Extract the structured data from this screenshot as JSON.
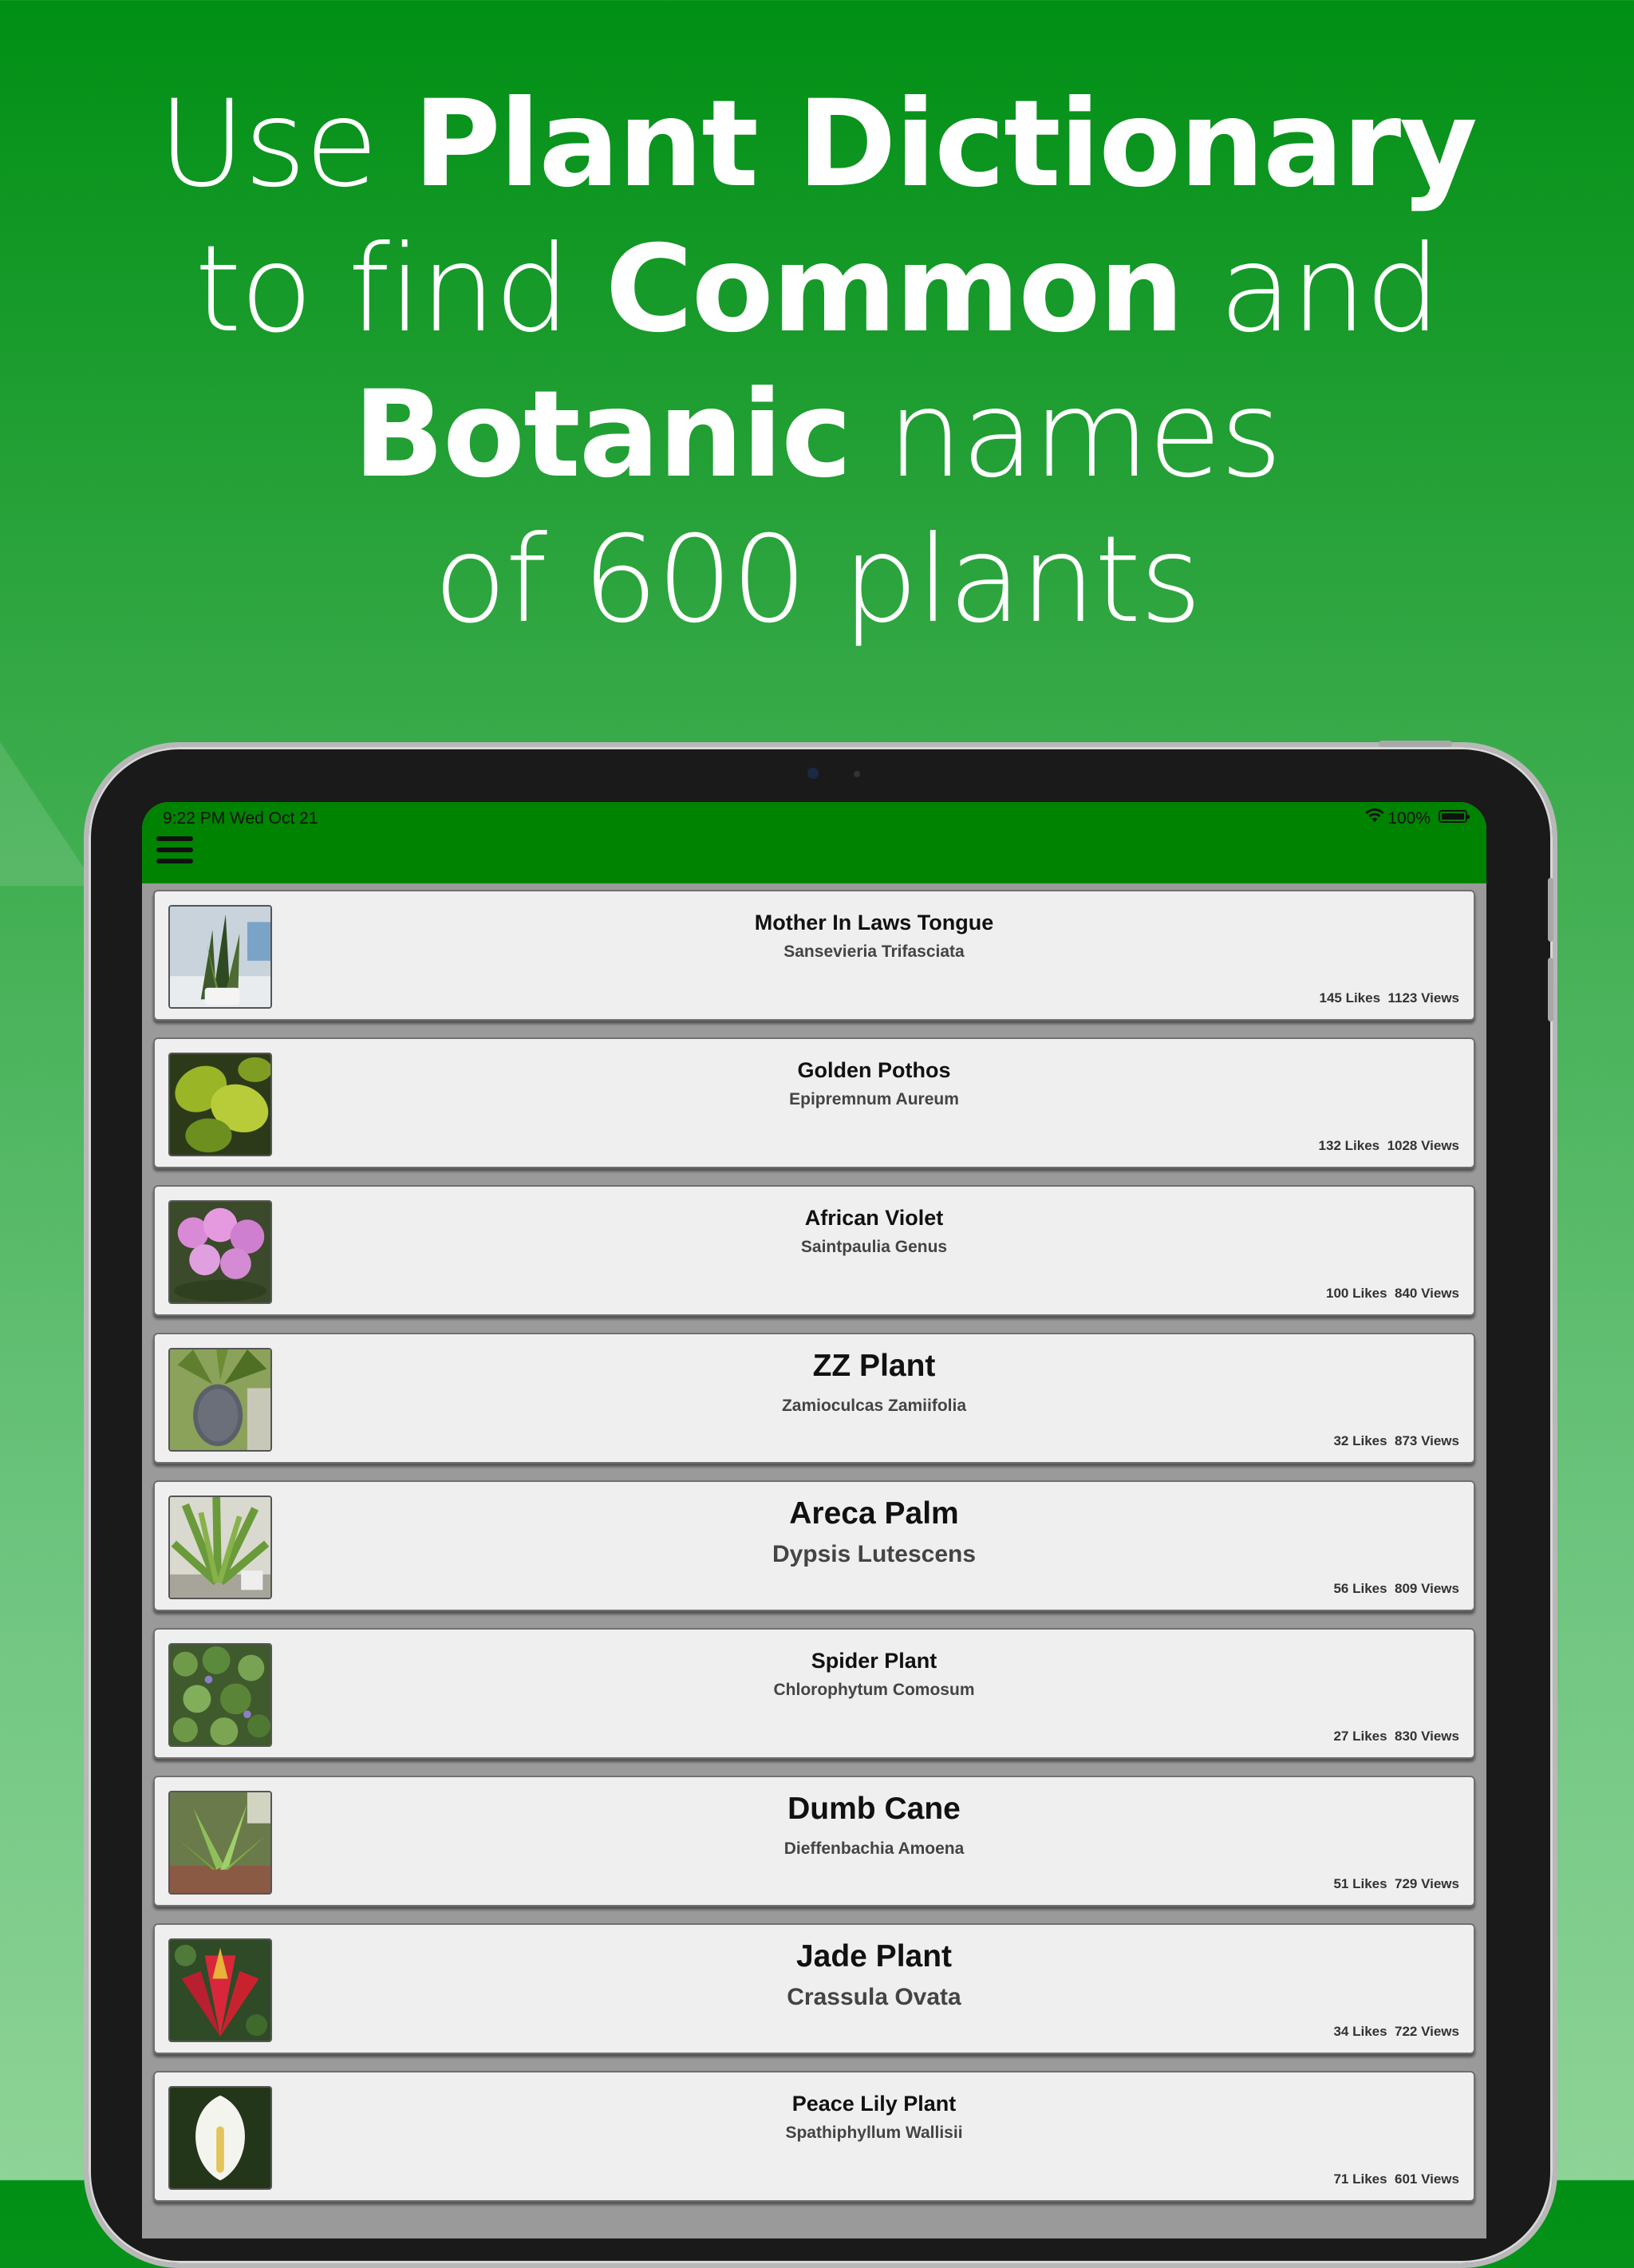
{
  "headline": {
    "line1_a": "Use ",
    "line1_b": "Plant Dictionary",
    "line2_a": "to find ",
    "line2_b": "Common",
    "line2_c": " and",
    "line3_a": "Botanic",
    "line3_b": " names",
    "line4": "of 600 plants"
  },
  "status_bar": {
    "time": "9:22 PM   Wed Oct 21",
    "battery": "100%"
  },
  "colors": {
    "app_bar": "#008300",
    "card_bg": "#efefef"
  },
  "plants": [
    {
      "common": "Mother In Laws Tongue",
      "botanic": "Sansevieria Trifasciata",
      "likes": "145 Likes",
      "views": "1123 Views",
      "icon": "snake-plant-thumbnail"
    },
    {
      "common": "Golden Pothos",
      "botanic": "Epipremnum Aureum",
      "likes": "132 Likes",
      "views": "1028 Views",
      "icon": "pothos-thumbnail"
    },
    {
      "common": "African Violet",
      "botanic": "Saintpaulia Genus",
      "likes": "100 Likes",
      "views": "840 Views",
      "icon": "african-violet-thumbnail"
    },
    {
      "common": "ZZ Plant",
      "botanic": "Zamioculcas Zamiifolia",
      "likes": "32 Likes",
      "views": "873 Views",
      "icon": "pineapple-thumbnail"
    },
    {
      "common": "Areca Palm",
      "botanic": "Dypsis Lutescens",
      "likes": "56 Likes",
      "views": "809 Views",
      "icon": "palm-thumbnail"
    },
    {
      "common": "Spider Plant",
      "botanic": "Chlorophytum Comosum",
      "likes": "27 Likes",
      "views": "830 Views",
      "icon": "leafy-groundcover-thumbnail"
    },
    {
      "common": "Dumb Cane",
      "botanic": "Dieffenbachia Amoena",
      "likes": "51 Likes",
      "views": "729 Views",
      "icon": "garden-plant-thumbnail"
    },
    {
      "common": "Jade Plant",
      "botanic": "Crassula Ovata",
      "likes": "34 Likes",
      "views": "722 Views",
      "icon": "red-bromeliad-thumbnail"
    },
    {
      "common": "Peace Lily Plant",
      "botanic": "Spathiphyllum Wallisii",
      "likes": "71 Likes",
      "views": "601 Views",
      "icon": "peace-lily-thumbnail"
    }
  ]
}
